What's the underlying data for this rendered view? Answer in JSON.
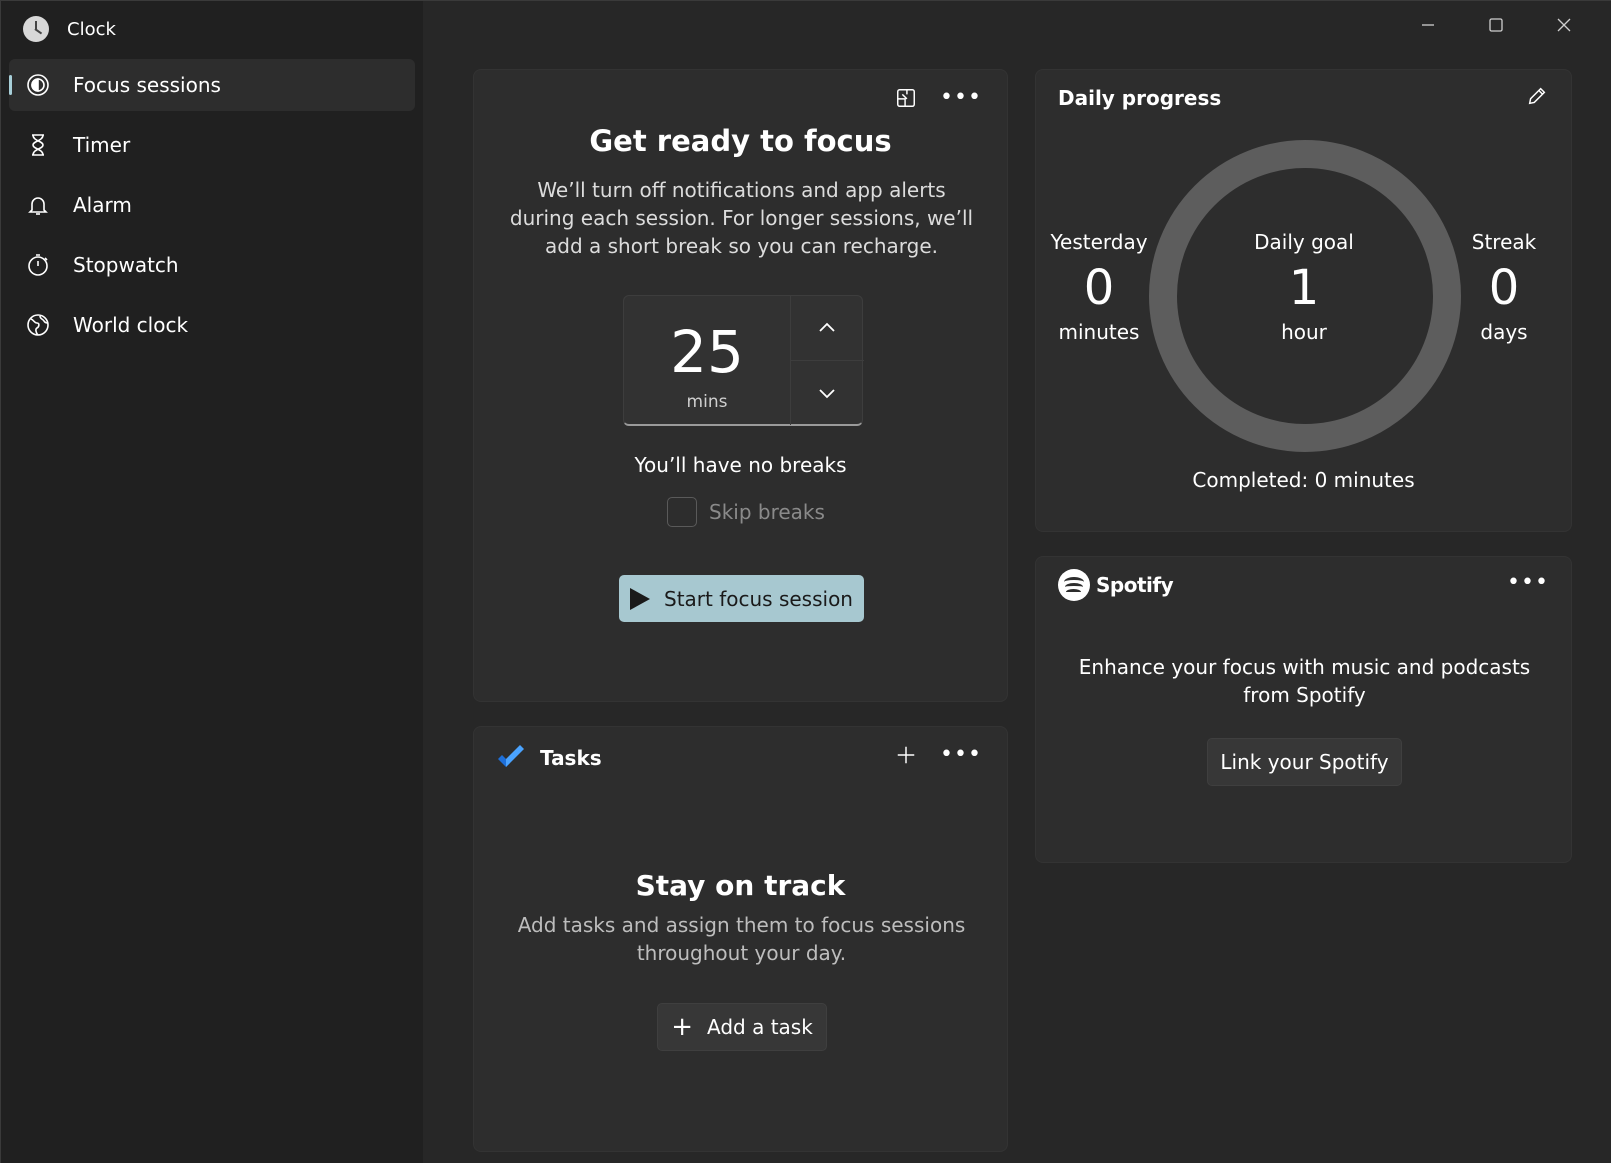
{
  "app": {
    "title": "Clock",
    "accent": "#a7c8d0"
  },
  "sidebar": {
    "items": [
      {
        "label": "Focus sessions",
        "icon": "focus-icon",
        "active": true
      },
      {
        "label": "Timer",
        "icon": "hourglass-icon",
        "active": false
      },
      {
        "label": "Alarm",
        "icon": "bell-icon",
        "active": false
      },
      {
        "label": "Stopwatch",
        "icon": "stopwatch-icon",
        "active": false
      },
      {
        "label": "World clock",
        "icon": "globe-icon",
        "active": false
      }
    ]
  },
  "window_controls": [
    "minimize-icon",
    "maximize-icon",
    "close-icon"
  ],
  "focus": {
    "title": "Get ready to focus",
    "description": "We’ll turn off notifications and app alerts during each session. For longer sessions, we’ll add a short break so you can recharge.",
    "duration_value": "25",
    "duration_unit": "mins",
    "breaks_text": "You’ll have no breaks",
    "skip_breaks_label": "Skip breaks",
    "skip_breaks_checked": false,
    "start_label": "Start focus session"
  },
  "tasks": {
    "title": "Tasks",
    "heading": "Stay on track",
    "description": "Add tasks and assign them to focus sessions throughout your day.",
    "add_label": "Add a task"
  },
  "daily": {
    "title": "Daily progress",
    "yesterday": {
      "label": "Yesterday",
      "value": "0",
      "unit": "minutes"
    },
    "goal": {
      "label": "Daily goal",
      "value": "1",
      "unit": "hour"
    },
    "streak": {
      "label": "Streak",
      "value": "0",
      "unit": "days"
    },
    "completed": "Completed: 0 minutes",
    "progress_fraction": 0
  },
  "spotify": {
    "name": "Spotify",
    "description": "Enhance your focus with music and podcasts from Spotify",
    "link_label": "Link your Spotify"
  }
}
